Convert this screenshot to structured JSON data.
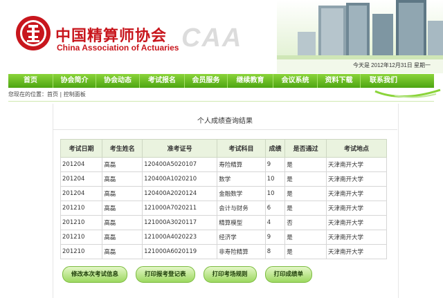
{
  "header": {
    "logo_cn": "中国精算师协会",
    "logo_en": "China Association of Actuaries",
    "watermark": "CAA",
    "date_text": "今天是 2012年12月31日 星期一"
  },
  "nav": {
    "items": [
      "首页",
      "协会简介",
      "协会动态",
      "考试报名",
      "会员服务",
      "继续教育",
      "会议系统",
      "资料下载",
      "联系我们"
    ]
  },
  "breadcrumb": {
    "prefix": "您现在的位置：",
    "home": "首页",
    "separator": "|",
    "current": "控制面板"
  },
  "panel": {
    "title": "个人成绩查询结果"
  },
  "table": {
    "headers": [
      "考试日期",
      "考生姓名",
      "准考证号",
      "考试科目",
      "成绩",
      "是否通过",
      "考试地点"
    ],
    "rows": [
      [
        "201204",
        "高磊",
        "120400A5020107",
        "寿险精算",
        "9",
        "是",
        "天津南开大学"
      ],
      [
        "201204",
        "高磊",
        "120400A1020210",
        "数学",
        "10",
        "是",
        "天津南开大学"
      ],
      [
        "201204",
        "高磊",
        "120400A2020124",
        "金融数学",
        "10",
        "是",
        "天津南开大学"
      ],
      [
        "201210",
        "高磊",
        "121000A7020211",
        "会计与财务",
        "6",
        "是",
        "天津南开大学"
      ],
      [
        "201210",
        "高磊",
        "121000A3020117",
        "精算模型",
        "4",
        "否",
        "天津南开大学"
      ],
      [
        "201210",
        "高磊",
        "121000A4020223",
        "经济学",
        "9",
        "是",
        "天津南开大学"
      ],
      [
        "201210",
        "高磊",
        "121000A6020119",
        "非寿险精算",
        "8",
        "是",
        "天津南开大学"
      ]
    ]
  },
  "buttons": {
    "edit": "修改本次考试信息",
    "print_register": "打印报考登记表",
    "print_rules": "打印考场规则",
    "print_score": "打印成绩单"
  },
  "colors": {
    "brand_red": "#c8161d",
    "nav_green": "#4da512",
    "header_green": "#eaf3df"
  }
}
